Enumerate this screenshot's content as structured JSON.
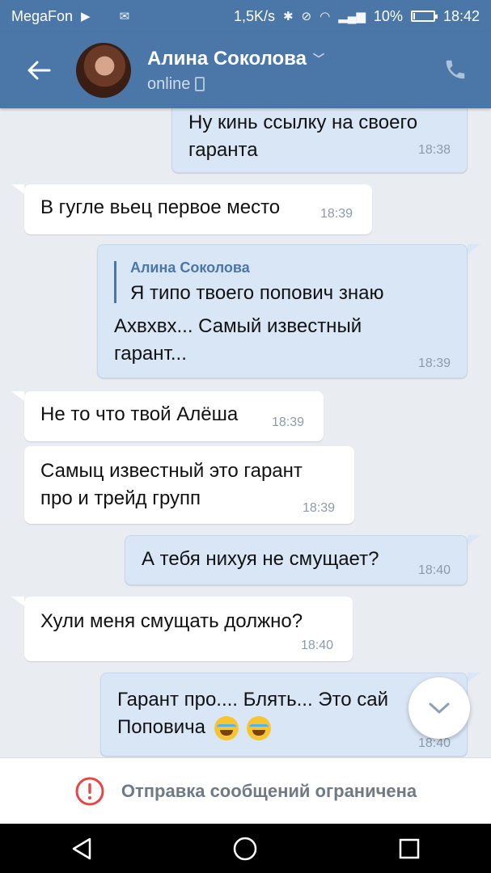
{
  "status_bar": {
    "carrier": "MegaFon",
    "speed": "1,5K/s",
    "battery_percent": "10%",
    "battery_level": 0.1,
    "time": "18:42"
  },
  "header": {
    "contact_name": "Алина Соколова",
    "status": "online"
  },
  "messages": [
    {
      "direction": "out",
      "lines": [
        "Ну кинь ссылку на своего",
        "гаранта"
      ],
      "time": "18:38"
    },
    {
      "direction": "in",
      "lines": [
        "В гугле вьец первое место"
      ],
      "time": "18:39"
    },
    {
      "direction": "out",
      "reply_author": "Алина Соколова",
      "reply_text": "Я типо твоего попович знаю",
      "lines": [
        "Ахвхвх... Самый известный",
        "гарант..."
      ],
      "time": "18:39"
    },
    {
      "direction": "in",
      "lines": [
        "Не то что твой Алёша"
      ],
      "time": "18:39"
    },
    {
      "direction": "in",
      "lines": [
        "Самыц известный это гарант",
        "про и трейд групп"
      ],
      "time": "18:39"
    },
    {
      "direction": "out",
      "lines": [
        "А тебя нихуя не смущает?"
      ],
      "time": "18:40"
    },
    {
      "direction": "in",
      "lines": [
        "Хули меня смущать должно?"
      ],
      "time": "18:40"
    },
    {
      "direction": "out",
      "lines": [
        "Гарант про.... Блять... Это сай",
        "Поповича"
      ],
      "time": "18:40",
      "emoji": [
        "face-with-tears-of-joy",
        "face-with-tears-of-joy"
      ]
    }
  ],
  "restriction": {
    "text": "Отправка сообщений ограничена"
  },
  "colors": {
    "accent": "#4a76a8",
    "outgoing_bubble": "#d9e6f6",
    "incoming_bubble": "#ffffff",
    "background": "#e9ecf0",
    "warning": "#e64646"
  }
}
